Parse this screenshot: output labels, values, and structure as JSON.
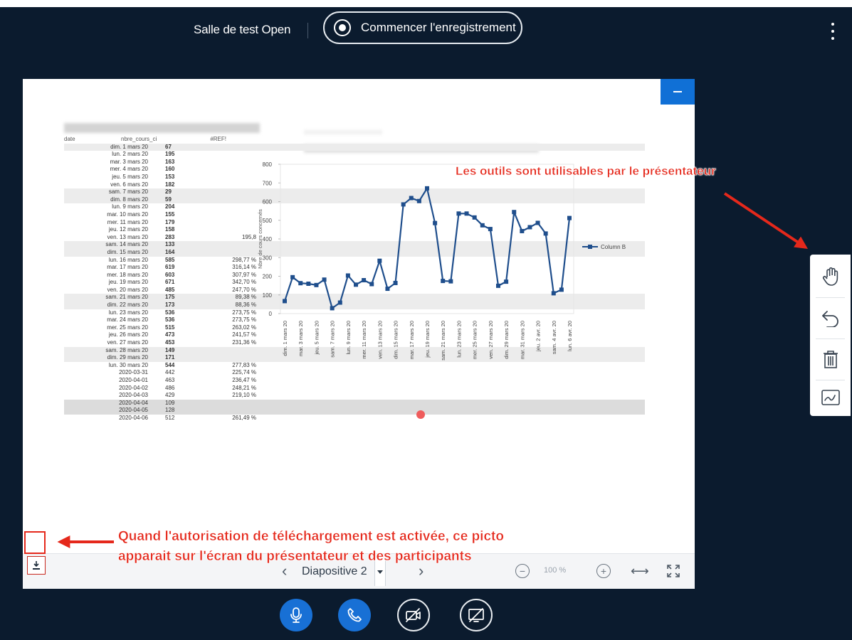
{
  "header": {
    "room_title": "Salle de test Open",
    "record_label": "Commencer l'enregistrement",
    "menu_icon": "kebab-menu-icon"
  },
  "slide_table": {
    "header": {
      "date": "date",
      "count": "nbre_cours_ci",
      "pct": "#REF!"
    },
    "rows": [
      {
        "date": "dim. 1 mars 20",
        "count": "67",
        "pct": ""
      },
      {
        "date": "lun. 2 mars 20",
        "count": "195",
        "pct": ""
      },
      {
        "date": "mar. 3 mars 20",
        "count": "163",
        "pct": ""
      },
      {
        "date": "mer. 4 mars 20",
        "count": "160",
        "pct": ""
      },
      {
        "date": "jeu. 5 mars 20",
        "count": "153",
        "pct": ""
      },
      {
        "date": "ven. 6 mars 20",
        "count": "182",
        "pct": ""
      },
      {
        "date": "sam. 7 mars 20",
        "count": "29",
        "pct": ""
      },
      {
        "date": "dim. 8 mars 20",
        "count": "59",
        "pct": ""
      },
      {
        "date": "lun. 9 mars 20",
        "count": "204",
        "pct": ""
      },
      {
        "date": "mar. 10 mars 20",
        "count": "155",
        "pct": ""
      },
      {
        "date": "mer. 11 mars 20",
        "count": "179",
        "pct": ""
      },
      {
        "date": "jeu. 12 mars 20",
        "count": "158",
        "pct": ""
      },
      {
        "date": "ven. 13 mars 20",
        "count": "283",
        "pct": "195,8"
      },
      {
        "date": "sam. 14 mars 20",
        "count": "133",
        "pct": ""
      },
      {
        "date": "dim. 15 mars 20",
        "count": "164",
        "pct": ""
      },
      {
        "date": "lun. 16 mars 20",
        "count": "585",
        "pct": "298,77 %"
      },
      {
        "date": "mar. 17 mars 20",
        "count": "619",
        "pct": "316,14 %"
      },
      {
        "date": "mer. 18 mars 20",
        "count": "603",
        "pct": "307,97 %"
      },
      {
        "date": "jeu. 19 mars 20",
        "count": "671",
        "pct": "342,70 %"
      },
      {
        "date": "ven. 20 mars 20",
        "count": "485",
        "pct": "247,70 %"
      },
      {
        "date": "sam. 21 mars 20",
        "count": "175",
        "pct": "89,38 %"
      },
      {
        "date": "dim. 22 mars 20",
        "count": "173",
        "pct": "88,36 %"
      },
      {
        "date": "lun. 23 mars 20",
        "count": "536",
        "pct": "273,75 %"
      },
      {
        "date": "mar. 24 mars 20",
        "count": "536",
        "pct": "273,75 %"
      },
      {
        "date": "mer. 25 mars 20",
        "count": "515",
        "pct": "263,02 %"
      },
      {
        "date": "jeu. 26 mars 20",
        "count": "473",
        "pct": "241,57 %"
      },
      {
        "date": "ven. 27 mars 20",
        "count": "453",
        "pct": "231,36 %"
      },
      {
        "date": "sam. 28 mars 20",
        "count": "149",
        "pct": ""
      },
      {
        "date": "dim. 29 mars 20",
        "count": "171",
        "pct": ""
      },
      {
        "date": "lun. 30 mars 20",
        "count": "544",
        "pct": "277,83 %"
      },
      {
        "date": "2020-03-31",
        "count": "442",
        "pct": "225,74 %"
      },
      {
        "date": "2020-04-01",
        "count": "463",
        "pct": "236,47 %"
      },
      {
        "date": "2020-04-02",
        "count": "486",
        "pct": "248,21 %"
      },
      {
        "date": "2020-04-03",
        "count": "429",
        "pct": "219,10 %"
      },
      {
        "date": "2020-04-04",
        "count": "109",
        "pct": ""
      },
      {
        "date": "2020-04-05",
        "count": "128",
        "pct": ""
      },
      {
        "date": "2020-04-06",
        "count": "512",
        "pct": "261,49 %"
      }
    ]
  },
  "chart_data": {
    "type": "line",
    "ylabel": "Nbre de cours concernés",
    "ylim": [
      0,
      800
    ],
    "yticks": [
      "0",
      "100",
      "200",
      "300",
      "400",
      "500",
      "600",
      "700",
      "800"
    ],
    "legend_position": "right",
    "color": "#1f4e8c",
    "categories": [
      "dim. 1 mars 20",
      "lun. 2 mars 20",
      "mar. 3 mars 20",
      "mer. 4 mars 20",
      "jeu. 5 mars 20",
      "ven. 6 mars 20",
      "sam. 7 mars 20",
      "dim. 8 mars 20",
      "lun. 9 mars 20",
      "mar. 10 mars 20",
      "mer. 11 mars 20",
      "jeu. 12 mars 20",
      "ven. 13 mars 20",
      "sam. 14 mars 20",
      "dim. 15 mars 20",
      "lun. 16 mars 20",
      "mar. 17 mars 20",
      "mer. 18 mars 20",
      "jeu. 19 mars 20",
      "ven. 20 mars 20",
      "sam. 21 mars 20",
      "dim. 22 mars 20",
      "lun. 23 mars 20",
      "mar. 24 mars 20",
      "mer. 25 mars 20",
      "jeu. 26 mars 20",
      "ven. 27 mars 20",
      "sam. 28 mars 20",
      "dim. 29 mars 20",
      "lun. 30 mars 20",
      "mar. 31 mars 20",
      "mer. 1 avr. 20",
      "jeu. 2 avr. 20",
      "ven. 3 avr. 20",
      "sam. 4 avr. 20",
      "dim. 5 avr. 20",
      "lun. 6 avr. 20"
    ],
    "tick_labels": [
      "dim. 1 mars 20",
      "mar. 3 mars 20",
      "jeu. 5 mars 20",
      "sam. 7 mars 20",
      "lun. 9 mars 20",
      "mer. 11 mars 20",
      "ven. 13 mars 20",
      "dim. 15 mars 20",
      "mar. 17 mars 20",
      "jeu. 19 mars 20",
      "sam. 21 mars 20",
      "lun. 23 mars 20",
      "mer. 25 mars 20",
      "ven. 27 mars 20",
      "dim. 29 mars 20",
      "mar. 31 mars 20",
      "jeu. 2 avr. 20",
      "sam. 4 avr. 20",
      "lun. 6 avr. 20"
    ],
    "series": [
      {
        "name": "Column B",
        "values": [
          67,
          195,
          163,
          160,
          153,
          182,
          29,
          59,
          204,
          155,
          179,
          158,
          283,
          133,
          164,
          585,
          619,
          603,
          671,
          485,
          175,
          173,
          536,
          536,
          515,
          473,
          453,
          149,
          171,
          544,
          442,
          463,
          486,
          429,
          109,
          128,
          512
        ]
      }
    ]
  },
  "slide_toolbar": {
    "download_icon": "download-icon",
    "prev_icon": "‹",
    "slide_label": "Diapositive 2",
    "next_icon": "›",
    "zoom_out_icon": "−",
    "zoom_label": "100 %",
    "zoom_in_icon": "+",
    "fit_width_icon": "⟷",
    "fullscreen_icon": "fullscreen-icon"
  },
  "tools": [
    "hand-icon",
    "undo-icon",
    "trash-icon",
    "pen-icon"
  ],
  "controls": [
    "microphone-icon",
    "phone-icon",
    "camera-off-icon",
    "screenshare-off-icon"
  ],
  "annotations": {
    "tools_note": "Les outils sont utilisables par le présentateur",
    "download_note_line1": "Quand l'autorisation de téléchargement est activée, ce picto",
    "download_note_line2": "apparait sur l'écran du présentateur et des participants",
    "color": "#e5281b"
  }
}
